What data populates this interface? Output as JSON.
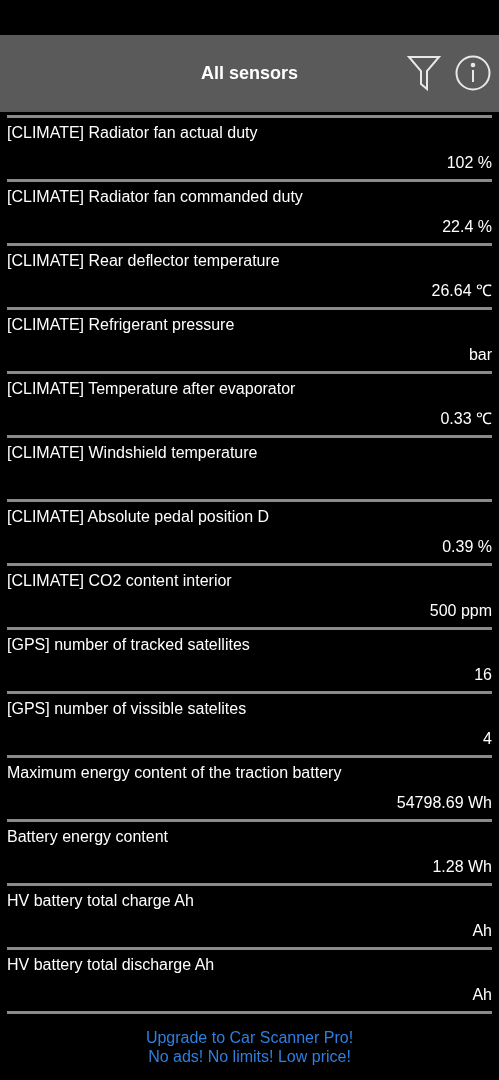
{
  "header": {
    "title": "All sensors"
  },
  "sensors": [
    {
      "name": "[CLIMATE] Radiator fan actual duty",
      "value": "102 %"
    },
    {
      "name": "[CLIMATE] Radiator fan commanded duty",
      "value": "22.4 %"
    },
    {
      "name": "[CLIMATE] Rear deflector temperature",
      "value": "26.64 ℃"
    },
    {
      "name": "[CLIMATE] Refrigerant pressure",
      "value": "bar"
    },
    {
      "name": "[CLIMATE] Temperature after evaporator",
      "value": "0.33 ℃"
    },
    {
      "name": "[CLIMATE] Windshield temperature"
    },
    {
      "name": "[CLIMATE] Absolute pedal position D",
      "value": "0.39 %"
    },
    {
      "name": "[CLIMATE] CO2 content interior",
      "value": "500 ppm"
    },
    {
      "name": "[GPS] number of tracked satellites",
      "value": "16"
    },
    {
      "name": "[GPS] number of vissible satelites",
      "value": "4"
    },
    {
      "name": "Maximum energy content of the traction battery",
      "value": "54798.69 Wh"
    },
    {
      "name": "Battery energy content",
      "value": "1.28 Wh"
    },
    {
      "name": "HV battery total charge Ah",
      "value": "Ah"
    },
    {
      "name": "HV battery total discharge Ah",
      "value": "Ah"
    }
  ],
  "promo": {
    "lines": [
      "Upgrade to Car Scanner Pro!",
      "No ads! No limits! Low price!"
    ]
  }
}
